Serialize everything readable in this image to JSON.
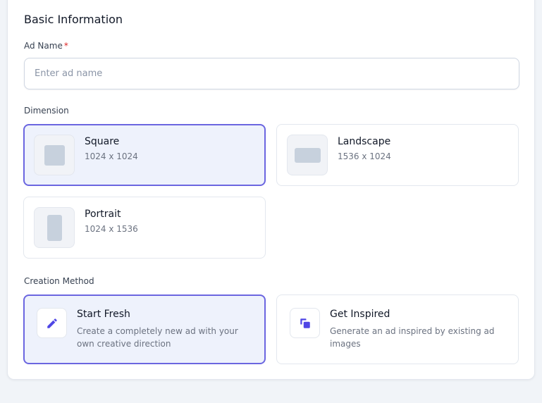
{
  "form": {
    "section_title": "Basic Information",
    "ad_name": {
      "label": "Ad Name",
      "required_marker": "*",
      "value": "",
      "placeholder": "Enter ad name"
    },
    "dimension": {
      "label": "Dimension",
      "selected": "Square",
      "options": [
        {
          "name": "Square",
          "size": "1024 x 1024",
          "icon": "square-shape-icon"
        },
        {
          "name": "Landscape",
          "size": "1536 x 1024",
          "icon": "landscape-shape-icon"
        },
        {
          "name": "Portrait",
          "size": "1024 x 1536",
          "icon": "portrait-shape-icon"
        }
      ]
    },
    "creation_method": {
      "label": "Creation Method",
      "selected": "Start Fresh",
      "options": [
        {
          "title": "Start Fresh",
          "description": "Create a completely new ad with your own creative direction",
          "icon": "pencil-icon"
        },
        {
          "title": "Get Inspired",
          "description": "Generate an ad inspired by existing ad images",
          "icon": "copy-icon"
        }
      ]
    }
  },
  "colors": {
    "accent": "#6b66e0",
    "accent_icon": "#4f46e5",
    "selected_bg": "#eef2fc",
    "required": "#dc2626",
    "page_bg": "#f1f4f8"
  }
}
